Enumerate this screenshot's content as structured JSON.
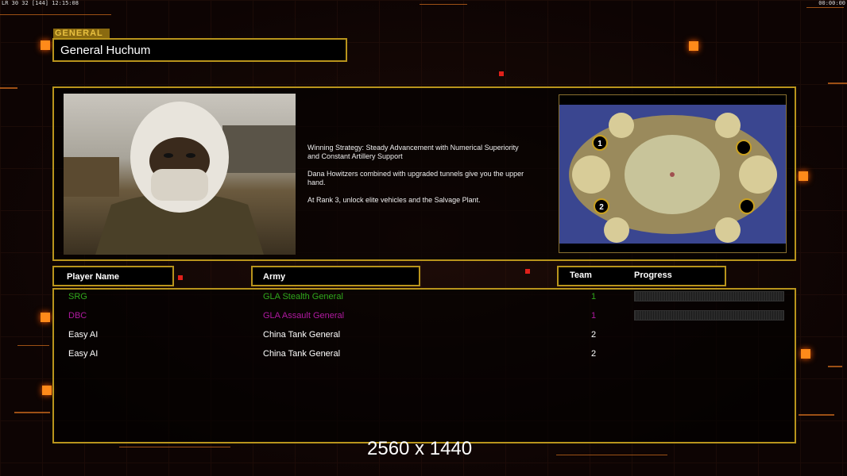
{
  "hud": {
    "left": "LR 30 32 [144] 12:15:08",
    "right": "00:00:00"
  },
  "general": {
    "tag": "GENERAL",
    "name": "General Huchum"
  },
  "description": [
    "Winning Strategy: Steady Advancement with Numerical Superiority\n and Constant Artillery Support",
    "Dana Howitzers combined with upgraded tunnels give you the upper\n hand.",
    "At Rank 3, unlock elite vehicles and the Salvage Plant."
  ],
  "map": {
    "start_positions": [
      "1",
      "2"
    ]
  },
  "table": {
    "headers": {
      "player": "Player Name",
      "army": "Army",
      "team": "Team",
      "progress": "Progress"
    },
    "rows": [
      {
        "player": "SRG",
        "army": "GLA Stealth General",
        "team": "1",
        "color": "#2fa81c",
        "progress": 0
      },
      {
        "player": "DBC",
        "army": "GLA Assault General",
        "team": "1",
        "color": "#b01aa0",
        "progress": 0
      },
      {
        "player": "Easy AI",
        "army": "China Tank General",
        "team": "2",
        "color": "#ffffff"
      },
      {
        "player": "Easy AI",
        "army": "China Tank General",
        "team": "2",
        "color": "#ffffff"
      }
    ]
  },
  "watermark": "2560 x 1440"
}
